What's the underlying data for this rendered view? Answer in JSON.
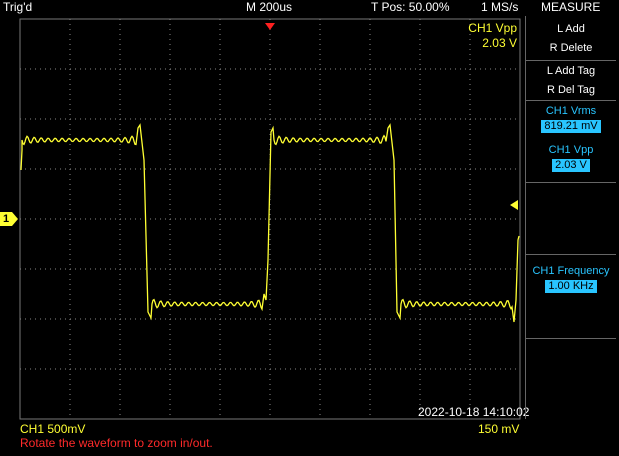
{
  "header": {
    "trigger_status": "Trig'd",
    "timebase": "M 200us",
    "trigger_position": "T Pos: 50.00%",
    "sample_rate": "1 MS/s",
    "menu_title": "MEASURE"
  },
  "overlay": {
    "measure_label": "CH1 Vpp",
    "measure_value": "2.03 V",
    "channel_marker": "1",
    "timestamp": "2022-10-18 14:10:02",
    "channel_scale": "CH1  500mV",
    "trigger_level": "150 mV",
    "hint": "Rotate the waveform to zoom in/out."
  },
  "side_menu": {
    "l_add": "L Add",
    "r_delete": "R Delete",
    "l_add_tag": "L Add Tag",
    "r_del_tag": "R Del Tag",
    "m1_label": "CH1 Vrms",
    "m1_value": "819.21 mV",
    "m2_label": "CH1 Vpp",
    "m2_value": "2.03 V",
    "m3_label": "CH1 Frequency",
    "m3_value": "1.00 KHz"
  },
  "colors": {
    "trace": "#ffff33",
    "accent": "#29c5ff",
    "hint": "#ff2a2a",
    "trigger_marker": "#ff2020"
  }
}
